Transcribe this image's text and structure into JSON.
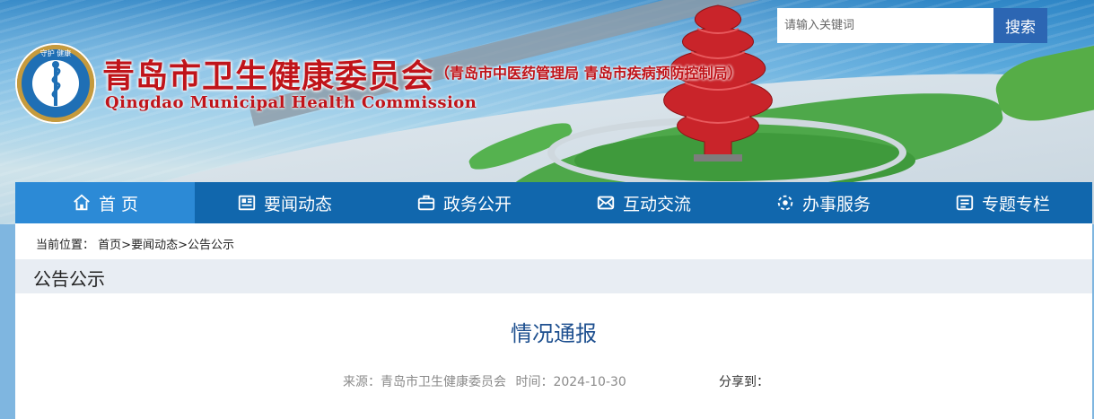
{
  "header": {
    "title_cn": "青岛市卫生健康委员会",
    "title_sub": "（青岛市中医药管理局  青岛市疾病预防控制局）",
    "title_en": "Qingdao Municipal Health Commission",
    "logo_text": "守护 健康",
    "logo_icon": "caduceus-emblem"
  },
  "search": {
    "placeholder": "请输入关键词",
    "button_label": "搜索"
  },
  "nav": {
    "items": [
      {
        "label": "首 页",
        "icon": "home-icon"
      },
      {
        "label": "要闻动态",
        "icon": "news-icon"
      },
      {
        "label": "政务公开",
        "icon": "briefcase-icon"
      },
      {
        "label": "互动交流",
        "icon": "exchange-icon"
      },
      {
        "label": "办事服务",
        "icon": "service-icon"
      },
      {
        "label": "专题专栏",
        "icon": "column-icon"
      }
    ],
    "active_index": 0
  },
  "breadcrumb": {
    "prefix": "当前位置：",
    "items": [
      "首页",
      "要闻动态",
      "公告公示"
    ],
    "separator": ">"
  },
  "section": {
    "title": "公告公示"
  },
  "article": {
    "title": "情况通报",
    "source_label": "来源：青岛市卫生健康委员会",
    "time_label": "时间：2024-10-30",
    "share_label": "分享到："
  },
  "colors": {
    "nav_bg": "#1167ad",
    "nav_active": "#2c8ad6",
    "title_red": "#c0141a",
    "article_title": "#1d4f8f",
    "search_btn": "#2c66b3"
  }
}
